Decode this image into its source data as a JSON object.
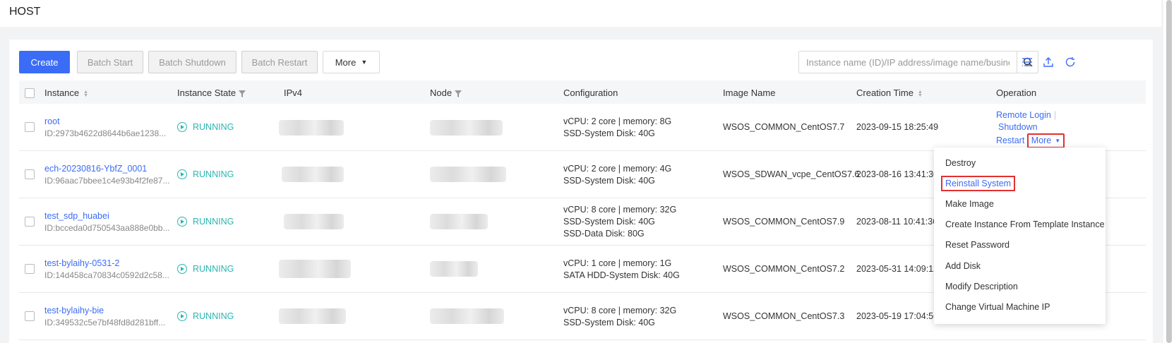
{
  "page": {
    "title": "HOST"
  },
  "toolbar": {
    "create": "Create",
    "batch_start": "Batch Start",
    "batch_shutdown": "Batch Shutdown",
    "batch_restart": "Batch Restart",
    "more": "More",
    "search_placeholder": "Instance name (ID)/IP address/image name/business group"
  },
  "icons": {
    "search": "search-icon",
    "column_settings": "list-settings-icon",
    "export": "upload-icon",
    "refresh": "refresh-icon",
    "state": "play-circle-icon"
  },
  "table": {
    "columns": [
      "Instance",
      "Instance State",
      "IPv4",
      "Node",
      "Configuration",
      "Image Name",
      "Creation Time",
      "Operation"
    ],
    "rows": [
      {
        "name": "root",
        "id": "ID:2973b4622d8644b6ae1238...",
        "state": "RUNNING",
        "config": [
          "vCPU: 2 core | memory: 8G",
          "SSD-System Disk:  40G"
        ],
        "image": "WSOS_COMMON_CentOS7.7",
        "created": "2023-09-15 18:25:49"
      },
      {
        "name": "ech-20230816-YbfZ_0001",
        "id": "ID:96aac7bbee1c4e93b4f2fe87...",
        "state": "RUNNING",
        "config": [
          "vCPU: 2 core | memory: 4G",
          "SSD-System Disk:  40G"
        ],
        "image": "WSOS_SDWAN_vcpe_CentOS7.6",
        "created": "2023-08-16 13:41:30"
      },
      {
        "name": "test_sdp_huabei",
        "id": "ID:bcceda0d750543aa888e0bb...",
        "state": "RUNNING",
        "config": [
          "vCPU: 8 core | memory: 32G",
          "SSD-System Disk:  40G",
          "SSD-Data Disk:  80G"
        ],
        "image": "WSOS_COMMON_CentOS7.9",
        "created": "2023-08-11 10:41:36"
      },
      {
        "name": "test-bylaihy-0531-2",
        "id": "ID:14d458ca70834c0592d2c58...",
        "state": "RUNNING",
        "config": [
          "vCPU: 1 core | memory: 1G",
          "SATA HDD-System Disk:  40G"
        ],
        "image": "WSOS_COMMON_CentOS7.2",
        "created": "2023-05-31 14:09:12"
      },
      {
        "name": "test-bylaihy-bie",
        "id": "ID:349532c5e7bf48fd8d281bff...",
        "state": "RUNNING",
        "config": [
          "vCPU: 8 core | memory: 32G",
          "SSD-System Disk:  40G"
        ],
        "image": "WSOS_COMMON_CentOS7.3",
        "created": "2023-05-19 17:04:56"
      }
    ]
  },
  "operations": {
    "remote_login": "Remote Login",
    "shutdown": "Shutdown",
    "restart": "Restart",
    "more": "More"
  },
  "more_menu": {
    "items": [
      "Destroy",
      "Reinstall System",
      "Make Image",
      "Create Instance From Template Instance",
      "Reset Password",
      "Add Disk",
      "Modify Description",
      "Change Virtual Machine IP"
    ],
    "highlighted": "Reinstall System"
  },
  "colors": {
    "primary": "#3b6cf6",
    "running": "#2bb5b0",
    "highlight_border": "#e23030"
  }
}
